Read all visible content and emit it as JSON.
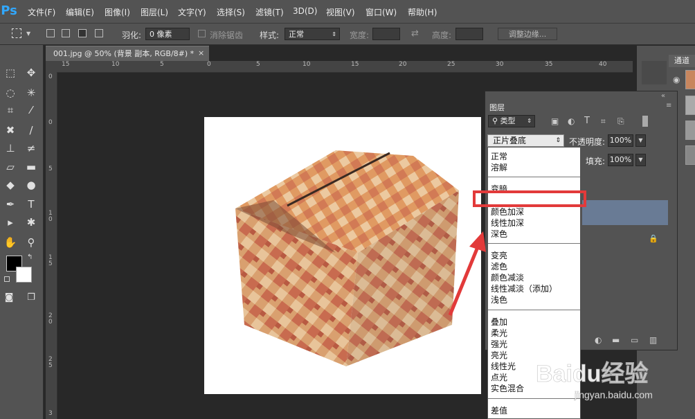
{
  "app": {
    "logo": "Ps"
  },
  "menu": [
    "文件(F)",
    "编辑(E)",
    "图像(I)",
    "图层(L)",
    "文字(Y)",
    "选择(S)",
    "滤镜(T)",
    "3D(D)",
    "视图(V)",
    "窗口(W)",
    "帮助(H)"
  ],
  "options": {
    "feather_label": "羽化:",
    "feather_value": "0 像素",
    "antialias_label": "消除锯齿",
    "style_label": "样式:",
    "style_value": "正常",
    "width_label": "宽度:",
    "height_label": "高度:",
    "refine_edge": "调整边缘..."
  },
  "document": {
    "tab_title": "001.jpg @ 50% (背景 副本, RGB/8#) *",
    "close": "×"
  },
  "ruler": {
    "top": [
      "15",
      "10",
      "5",
      "0",
      "5",
      "10",
      "15",
      "20",
      "25",
      "30",
      "35",
      "40"
    ],
    "left": [
      "0",
      "0",
      "5",
      "1",
      "0",
      "1",
      "5",
      "2",
      "0",
      "2",
      "5",
      "3"
    ]
  },
  "channels": {
    "tab": "通道"
  },
  "layers": {
    "title": "图层",
    "kind": "类型",
    "blend_mode": "正片叠底",
    "opacity_label": "不透明度:",
    "opacity_value": "100%",
    "fill_label": "填充:",
    "fill_value": "100%"
  },
  "blend_dropdown": {
    "groups": [
      [
        "正常",
        "溶解"
      ],
      [
        "变暗",
        "正片叠底",
        "颜色加深",
        "线性加深",
        "深色"
      ],
      [
        "变亮",
        "滤色",
        "颜色减淡",
        "线性减淡（添加）",
        "浅色"
      ],
      [
        "叠加",
        "柔光",
        "强光",
        "亮光",
        "线性光",
        "点光",
        "实色混合"
      ],
      [
        "差值"
      ]
    ],
    "selected": "正片叠底"
  },
  "watermark": {
    "brand": "Baidu经验",
    "url": "jingyan.baidu.com"
  },
  "colors": {
    "highlight": "#3e8ad9",
    "annotation": "#e23a3a",
    "ps_blue": "#31a8ff"
  }
}
